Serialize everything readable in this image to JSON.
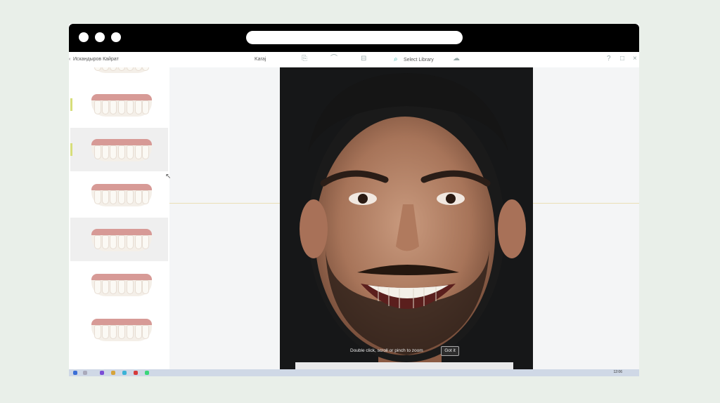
{
  "toolbar": {
    "patient_name": "Искандыров Кайрат",
    "section_label": "Karaj",
    "library_button": "Select Library",
    "tool_icons": [
      "photo-adjust-icon",
      "smile-frame-icon",
      "ruler-icon"
    ],
    "right_icons": [
      "help-icon",
      "window-icon",
      "close-icon"
    ]
  },
  "sidebar": {
    "items": [
      {
        "id": "smile-1",
        "selected": false,
        "marker": "none"
      },
      {
        "id": "smile-2",
        "selected": false,
        "marker": "#d7de7a"
      },
      {
        "id": "smile-3",
        "selected": true,
        "marker": "#d7de7a"
      },
      {
        "id": "smile-4",
        "selected": false,
        "marker": "none"
      },
      {
        "id": "smile-5",
        "selected": true,
        "marker": "none"
      },
      {
        "id": "smile-6",
        "selected": false,
        "marker": "none"
      },
      {
        "id": "smile-7",
        "selected": false,
        "marker": "none"
      }
    ]
  },
  "canvas": {
    "zoom_hint": "Double click, scroll or pinch to zoom",
    "got_it": "Got it"
  },
  "taskbar": {
    "clock": "12:06"
  },
  "colors": {
    "accent": "#6bc9c0",
    "browser_chrome": "#000000",
    "background": "#e9efe9"
  }
}
